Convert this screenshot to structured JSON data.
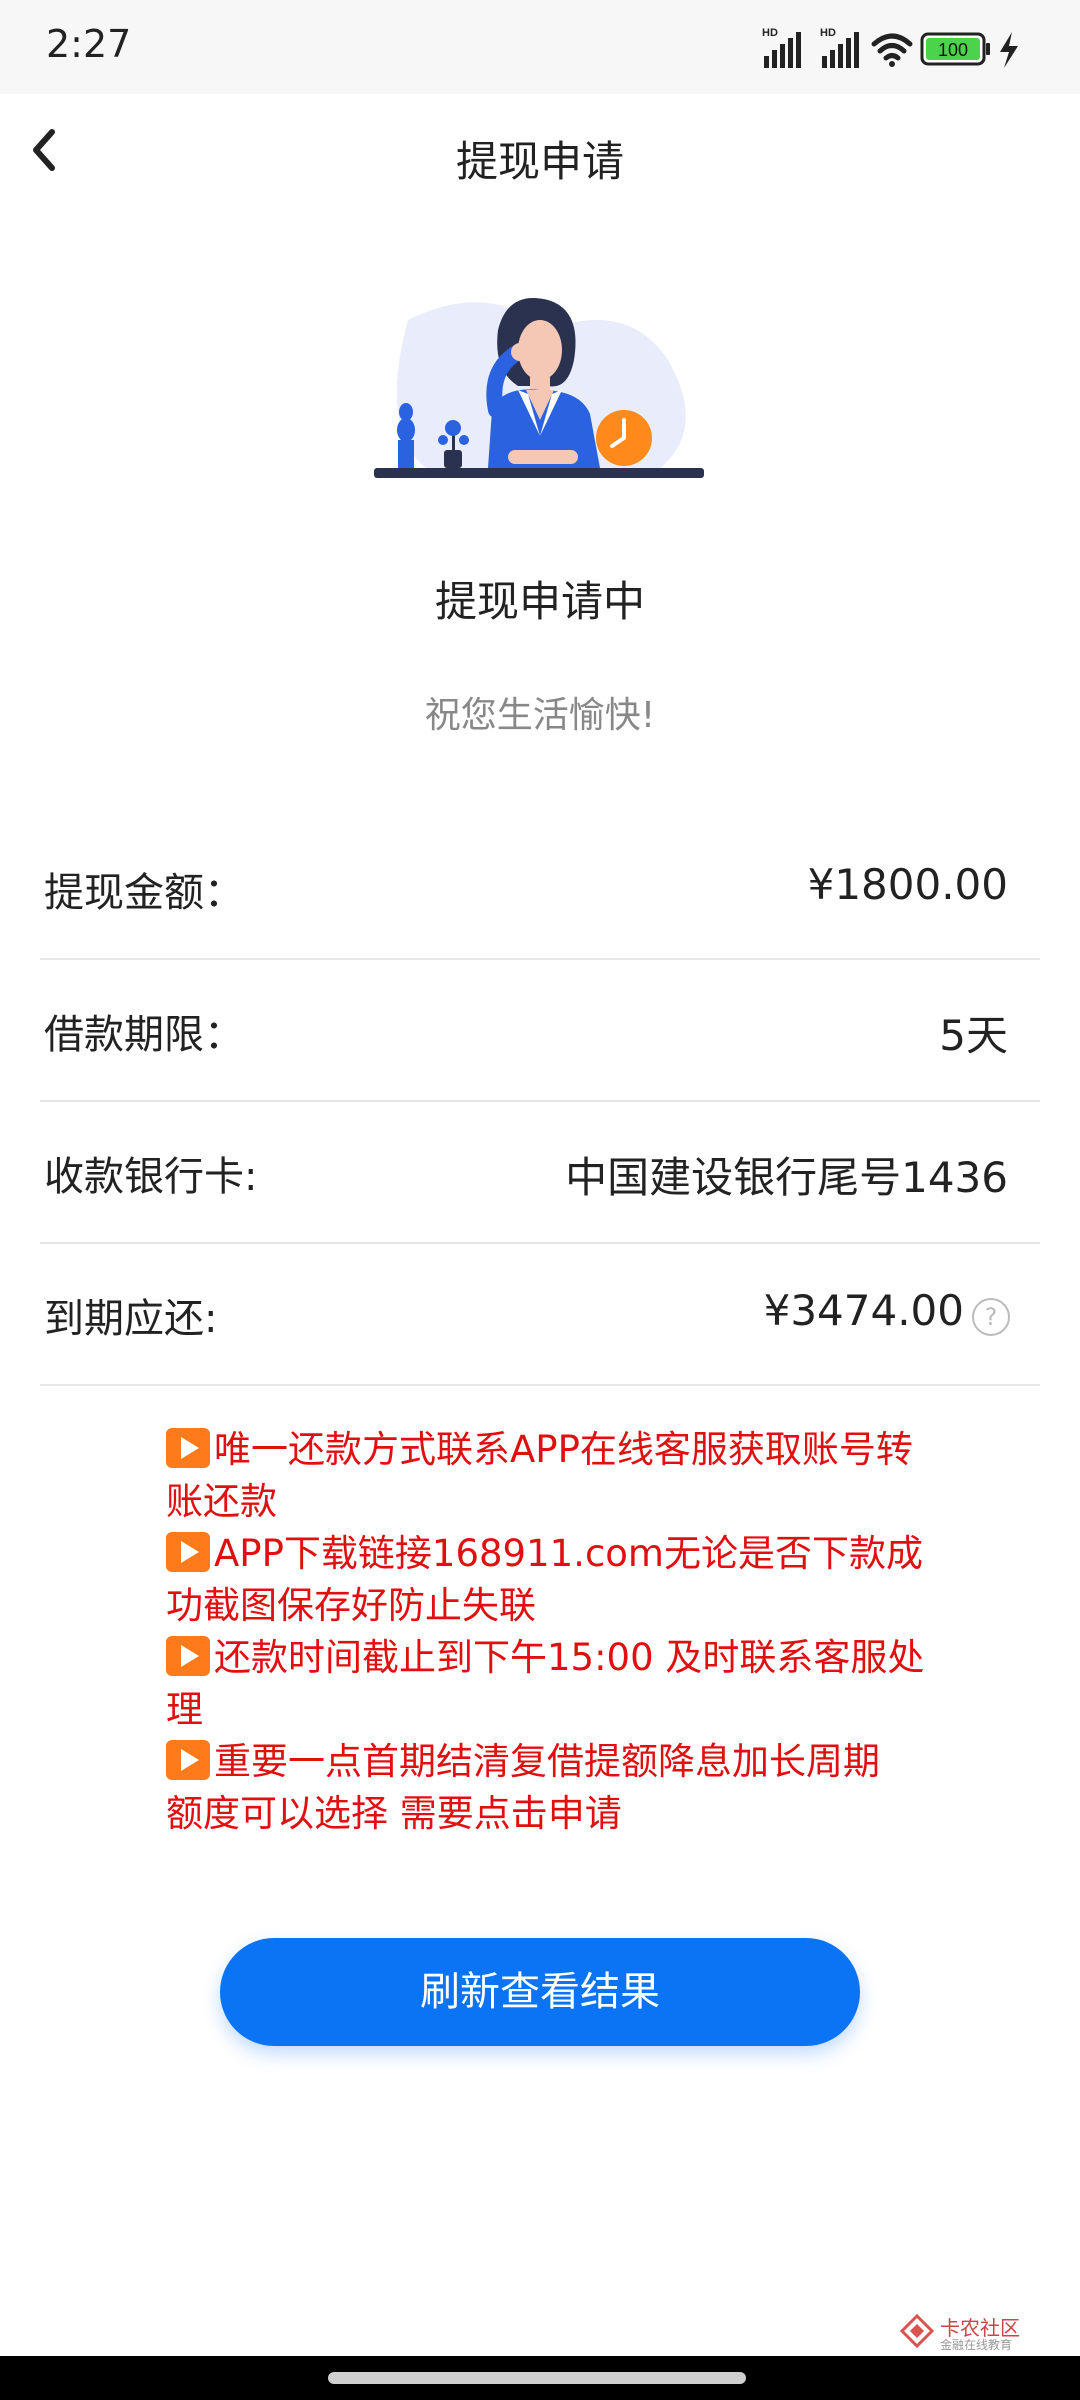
{
  "status_bar": {
    "time": "2:27",
    "network_1": "HD",
    "network_2": "HD",
    "battery": "100"
  },
  "nav": {
    "title": "提现申请",
    "back_icon": "chevron-left-icon"
  },
  "main": {
    "title": "提现申请中",
    "subtitle": "祝您生活愉快!"
  },
  "details": [
    {
      "label": "提现金额：",
      "value": "¥1800.00"
    },
    {
      "label": "借款期限：",
      "value": "5天"
    },
    {
      "label": "收款银行卡:",
      "value": "中国建设银行尾号1436"
    },
    {
      "label": "到期应还:",
      "value": "¥3474.00"
    }
  ],
  "notice": [
    "唯一还款方式联系APP在线客服获取账号转账还款",
    "APP下载链接168911.com无论是否下款成功截图保存好防止失联",
    "还款时间截止到下午15:00 及时联系客服处理",
    "重要一点首期结清复借提额降息加长周期 额度可以选择 需要点击申请"
  ],
  "button": {
    "refresh_label": "刷新查看结果"
  },
  "watermark": {
    "text": "卡农社区",
    "sub": "金融在线教育"
  },
  "colors": {
    "accent": "#0a74f5",
    "notice": "#e01010"
  }
}
